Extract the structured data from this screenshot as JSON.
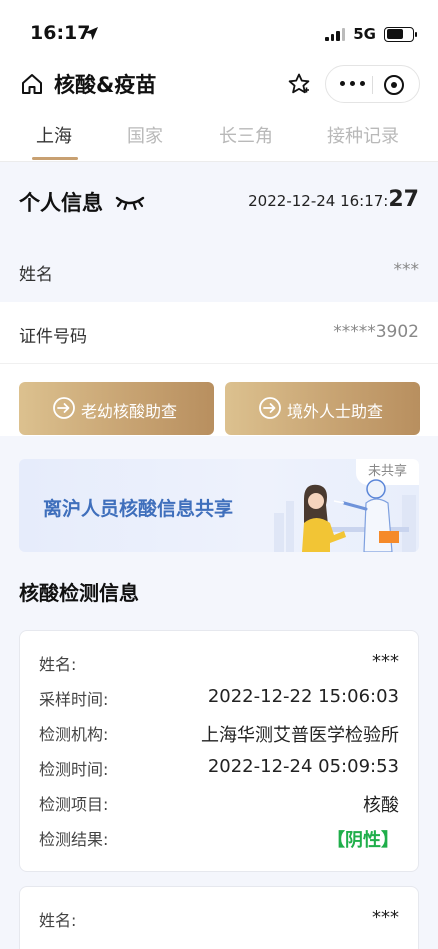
{
  "status_bar": {
    "time": "16:17",
    "network": "5G"
  },
  "nav": {
    "title": "核酸&疫苗"
  },
  "tabs": [
    {
      "label": "上海",
      "active": true
    },
    {
      "label": "国家",
      "active": false
    },
    {
      "label": "长三角",
      "active": false
    },
    {
      "label": "接种记录",
      "active": false
    }
  ],
  "personal_info": {
    "title": "个人信息",
    "timestamp": "2022-12-24 16:17:",
    "timestamp_seconds": "27",
    "name_label": "姓名",
    "name_value": "***",
    "id_label": "证件号码",
    "id_value": "*****3902"
  },
  "buttons": {
    "elderly_child": "老幼核酸助查",
    "foreigner": "境外人士助查"
  },
  "banner": {
    "text": "离沪人员核酸信息共享",
    "badge": "未共享"
  },
  "test_section": {
    "title": "核酸检测信息"
  },
  "records": [
    {
      "name_label": "姓名:",
      "name": "***",
      "sample_time_label": "采样时间:",
      "sample_time": "2022-12-22 15:06:03",
      "institution_label": "检测机构:",
      "institution": "上海华测艾普医学检验所",
      "test_time_label": "检测时间:",
      "test_time": "2022-12-24 05:09:53",
      "item_label": "检测项目:",
      "item": "核酸",
      "result_label": "检测结果:",
      "result": "【阴性】"
    },
    {
      "name_label": "姓名:",
      "name": "***"
    }
  ],
  "colors": {
    "accent_gold": "#c8a071",
    "banner_blue": "#3f6fbc",
    "negative_green": "#1fae4a",
    "page_bg": "#f4f6fc"
  }
}
